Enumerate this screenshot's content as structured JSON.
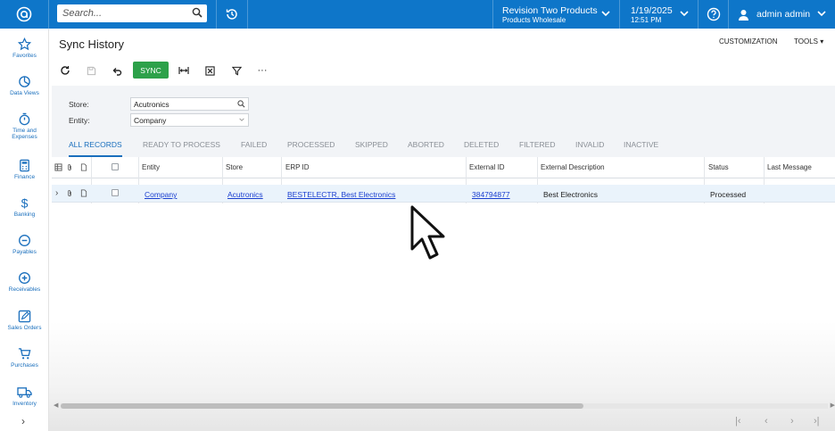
{
  "topbar": {
    "search_placeholder": "Search...",
    "company_line1": "Revision Two Products",
    "company_line2": "Products Wholesale",
    "date": "1/19/2025",
    "time": "12:51 PM",
    "user_name": "admin admin",
    "accent_color": "#0e76c9"
  },
  "nav": {
    "items": [
      {
        "label": "Favorites",
        "icon": "star-icon"
      },
      {
        "label": "Data Views",
        "icon": "pie-chart-icon"
      },
      {
        "label": "Time and Expenses",
        "icon": "stopwatch-icon"
      },
      {
        "label": "Finance",
        "icon": "calculator-icon"
      },
      {
        "label": "Banking",
        "icon": "dollar-icon"
      },
      {
        "label": "Payables",
        "icon": "minus-circle-icon"
      },
      {
        "label": "Receivables",
        "icon": "plus-circle-icon"
      },
      {
        "label": "Sales Orders",
        "icon": "pencil-icon"
      },
      {
        "label": "Purchases",
        "icon": "cart-icon"
      },
      {
        "label": "Inventory",
        "icon": "truck-icon"
      }
    ],
    "expand": "›"
  },
  "page": {
    "title": "Sync History",
    "customization": "CUSTOMIZATION",
    "tools": "TOOLS",
    "sync_label": "SYNC",
    "more": "···"
  },
  "form": {
    "store_label": "Store:",
    "store_value": "Acutronics",
    "entity_label": "Entity:",
    "entity_value": "Company"
  },
  "tabs": [
    "ALL RECORDS",
    "READY TO PROCESS",
    "FAILED",
    "PROCESSED",
    "SKIPPED",
    "ABORTED",
    "DELETED",
    "FILTERED",
    "INVALID",
    "INACTIVE"
  ],
  "grid": {
    "headers": [
      "Entity",
      "Store",
      "ERP ID",
      "External ID",
      "External Description",
      "Status",
      "Last Message"
    ],
    "rows": [
      {
        "entity": "Company",
        "store": "Acutronics",
        "erp_id": "BESTELECTR, Best Electronics",
        "external_id": "384794877",
        "external_description": "Best Electronics",
        "status": "Processed",
        "last_message": ""
      }
    ]
  },
  "pager": [
    "|‹",
    "‹",
    "›",
    "›|"
  ]
}
